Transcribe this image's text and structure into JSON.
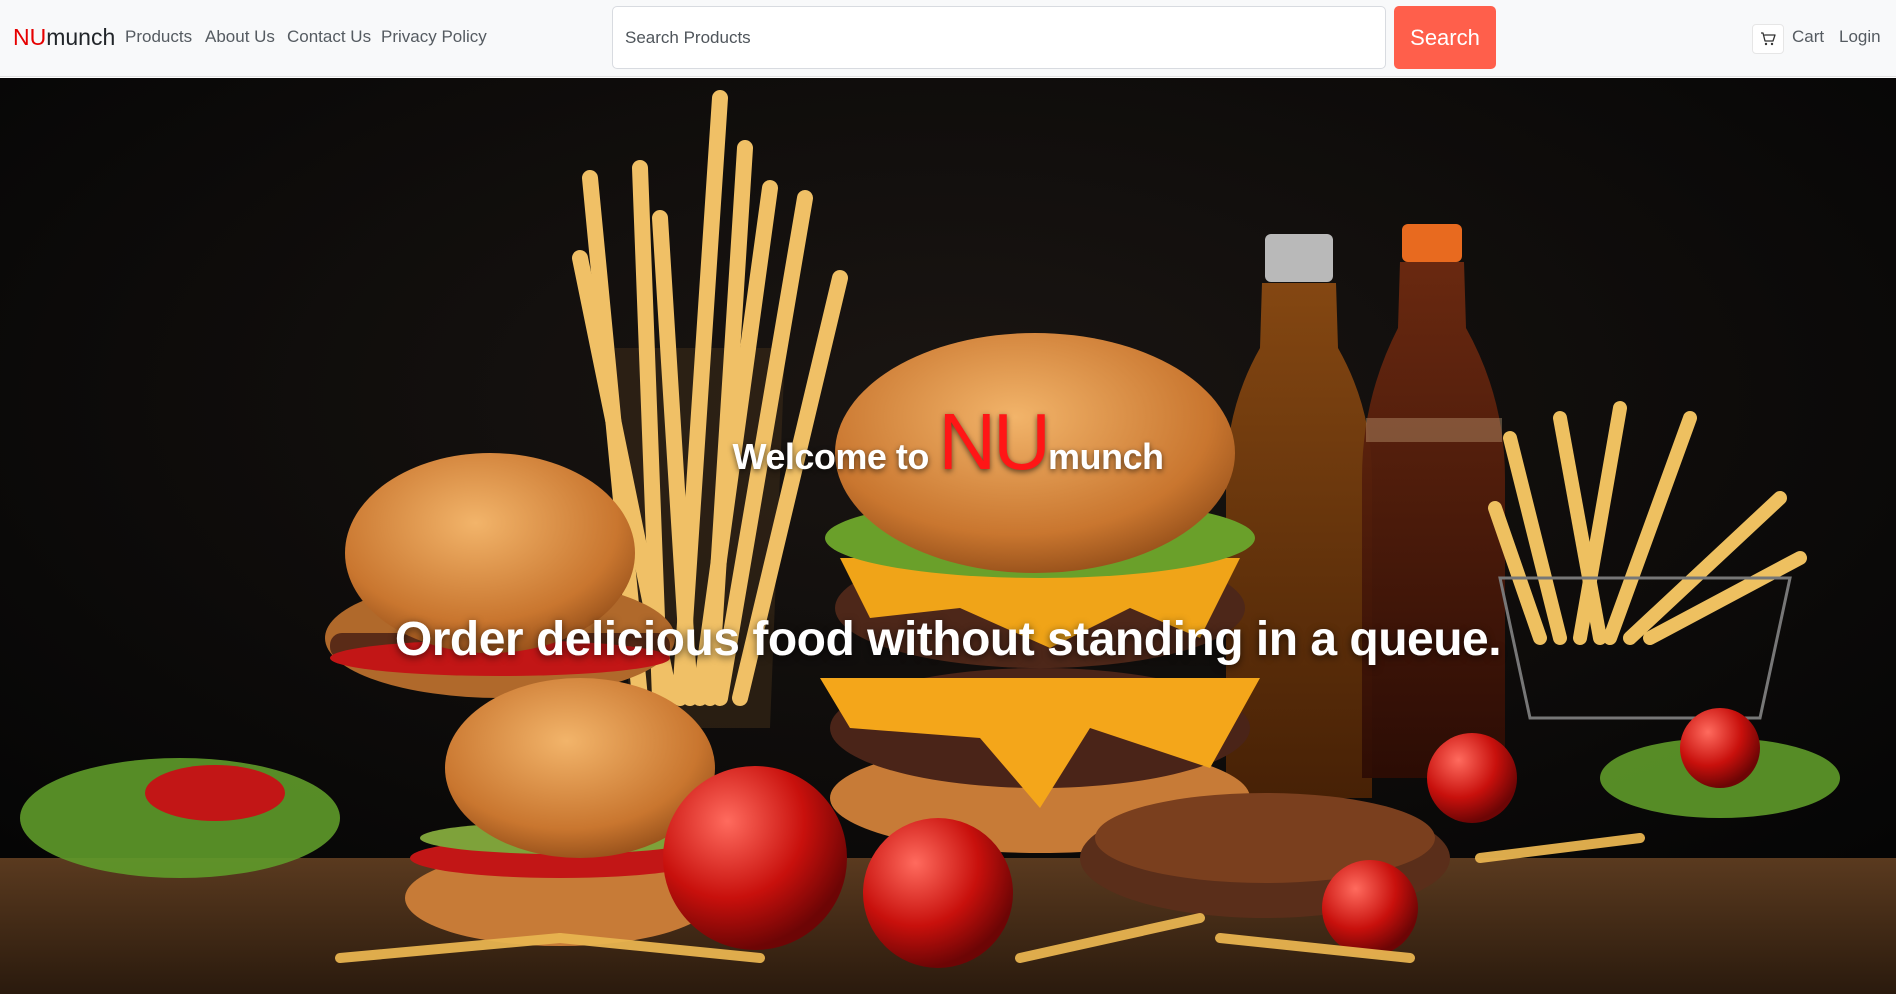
{
  "navbar": {
    "brand_prefix": "NU",
    "brand_suffix": "munch",
    "links": [
      "Products",
      "About Us",
      "Contact Us",
      "Privacy Policy"
    ],
    "search": {
      "placeholder": "Search Products",
      "button_label": "Search"
    },
    "cart_icon": "cart-icon",
    "cart_label": "Cart",
    "login_label": "Login"
  },
  "hero": {
    "welcome_prefix": "Welcome to",
    "welcome_nu": "NU",
    "welcome_munch": "munch",
    "tagline": "Order delicious food without standing in a queue."
  },
  "colors": {
    "brand_accent": "#e60000",
    "search_button": "#ff5f4b",
    "navbar_bg": "#f8f9fa"
  }
}
